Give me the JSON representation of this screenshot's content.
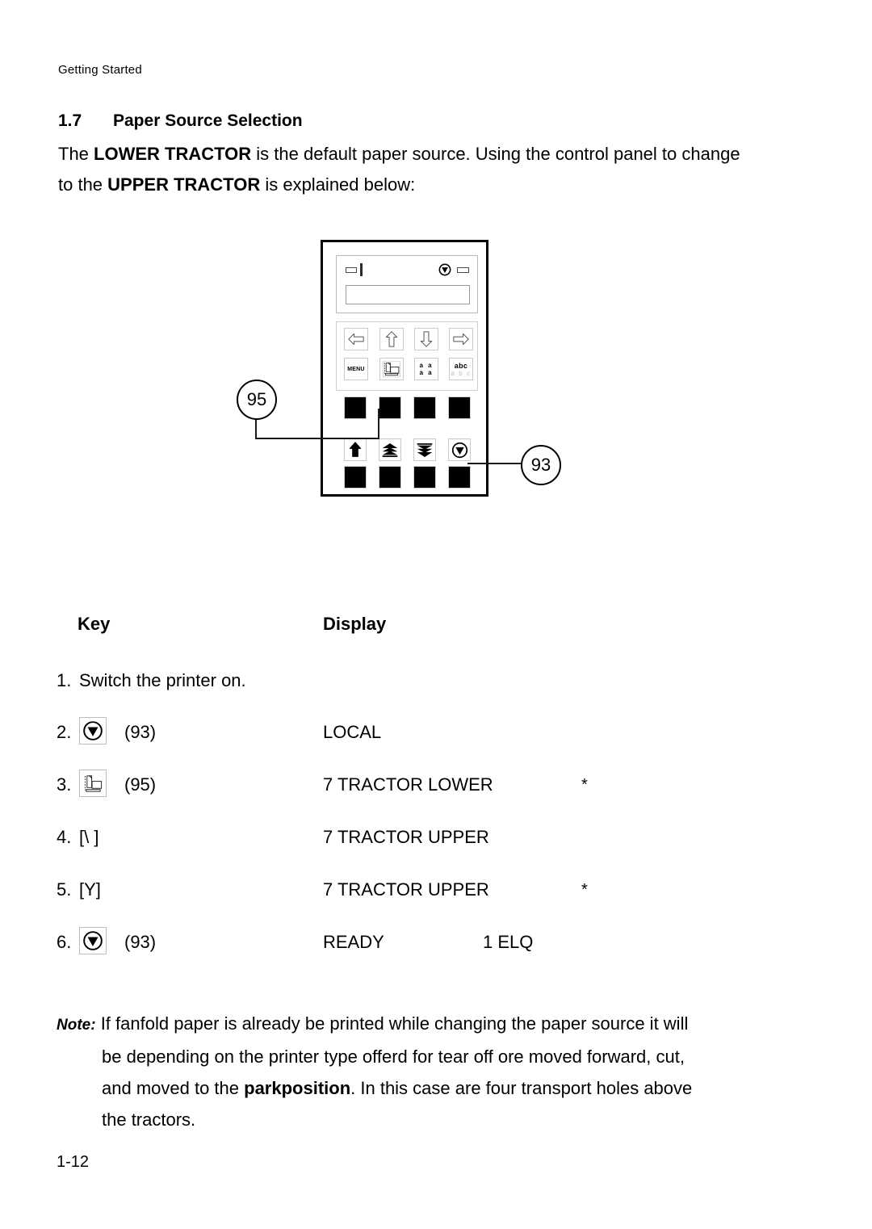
{
  "header": {
    "running_head": "Getting Started"
  },
  "section": {
    "number": "1.7",
    "title": "Paper Source Selection"
  },
  "intro": {
    "line1_a": "The ",
    "line1_bold": "LOWER TRACTOR",
    "line1_b": " is the default paper source. Using the control panel to change to the ",
    "line1_bold2": "UPPER TRACTOR",
    "line1_c": " is explained below:"
  },
  "panel": {
    "display": {
      "led_left_icon": "led-indicator-icon",
      "led_bar_icon": "led-bar-icon",
      "stop-indicator-icon": "stop-indicator-icon",
      "led_right_icon": "led-indicator-icon",
      "lcd_text": ""
    },
    "menu_keys_row1": [
      {
        "name": "arrow-left-icon",
        "label": ""
      },
      {
        "name": "arrow-up-icon",
        "label": ""
      },
      {
        "name": "arrow-down-icon",
        "label": ""
      },
      {
        "name": "arrow-right-icon",
        "label": ""
      }
    ],
    "menu_keys_row2": [
      {
        "name": "menu-key",
        "label": "MENU"
      },
      {
        "name": "paper-source-key",
        "label": ""
      },
      {
        "name": "font-size-key",
        "label_top": "a a",
        "label_bottom": "a a"
      },
      {
        "name": "character-set-key",
        "label_top": "abc",
        "label_bottom": "a b c"
      }
    ],
    "function_keys": [
      {
        "name": "form-feed-up-key"
      },
      {
        "name": "paper-stack-up-key"
      },
      {
        "name": "paper-stack-down-key"
      },
      {
        "name": "stop-key"
      }
    ],
    "callouts": [
      {
        "id": "95",
        "points_to": "paper-source-button"
      },
      {
        "id": "93",
        "points_to": "stop-button"
      }
    ]
  },
  "table": {
    "col_key": "Key",
    "col_display": "Display",
    "rows": [
      {
        "index": "1.",
        "key_text": "Switch the printer on.",
        "key_icon": "",
        "key_ref": "",
        "display": "",
        "display2": "",
        "star": ""
      },
      {
        "index": "2.",
        "key_text": "",
        "key_icon": "stop-key-icon",
        "key_ref": "(93)",
        "display": "LOCAL",
        "display2": "",
        "star": ""
      },
      {
        "index": "3.",
        "key_text": "",
        "key_icon": "paper-source-key-icon",
        "key_ref": "(95)",
        "display": "7 TRACTOR LOWER",
        "display2": "",
        "star": "*"
      },
      {
        "index": "4.",
        "key_text": "[\\ ]",
        "key_icon": "",
        "key_ref": "",
        "display": "7 TRACTOR UPPER",
        "display2": "",
        "star": ""
      },
      {
        "index": "5.",
        "key_text": "[Y]",
        "key_icon": "",
        "key_ref": "",
        "display": "7 TRACTOR UPPER",
        "display2": "",
        "star": "*"
      },
      {
        "index": "6.",
        "key_text": "",
        "key_icon": "stop-key-icon",
        "key_ref": "(93)",
        "display": "READY",
        "display2": "1 ELQ",
        "star": ""
      }
    ]
  },
  "note": {
    "label": "Note:",
    "line1": "If fanfold paper is already be printed while changing the paper source it will",
    "line2": "be depending on the printer type offerd for tear off ore moved forward, cut,",
    "line3_a": "and moved to the ",
    "line3_bold": "parkposition",
    "line3_b": ". In this case are four transport holes above",
    "line4": "the tractors."
  },
  "footer": {
    "folio": "1-12"
  }
}
